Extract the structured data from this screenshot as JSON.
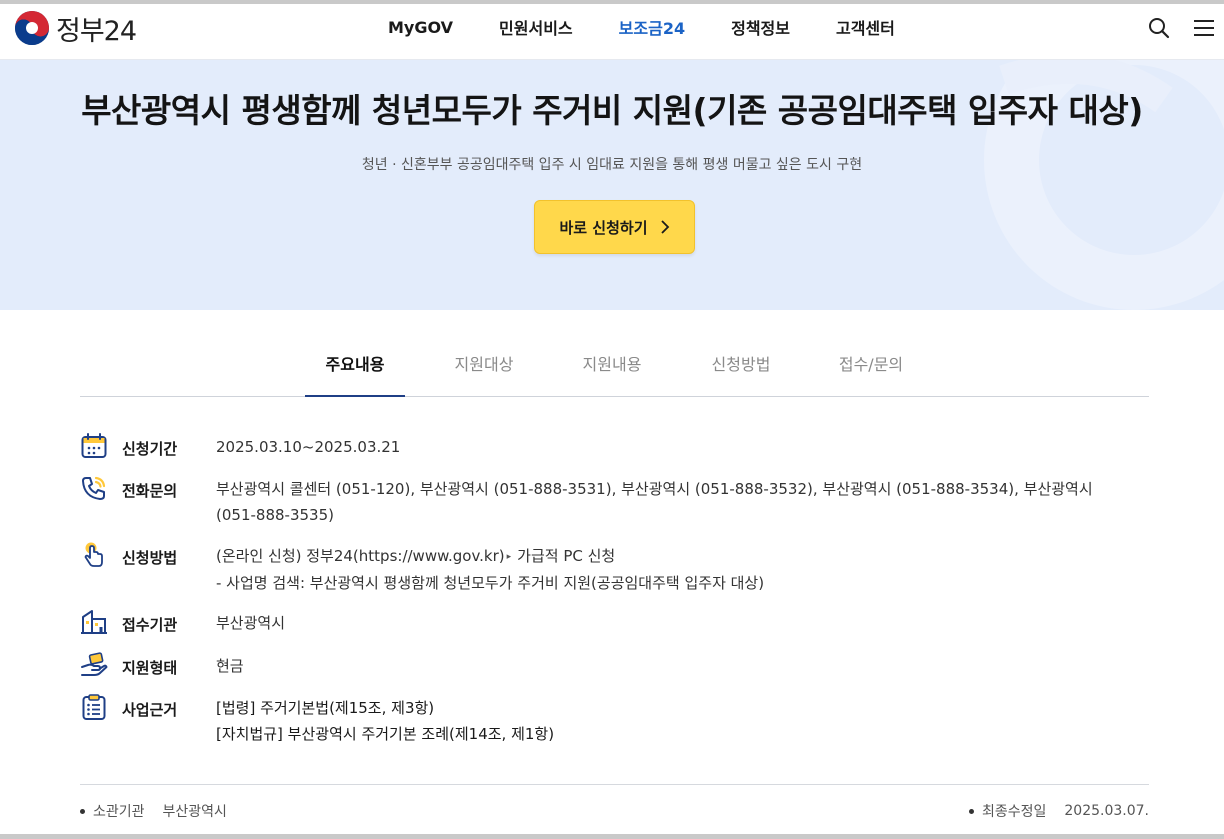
{
  "header": {
    "logo_text": "정부24",
    "nav": [
      {
        "label": "MyGOV",
        "active": false
      },
      {
        "label": "민원서비스",
        "active": false
      },
      {
        "label": "보조금24",
        "active": true
      },
      {
        "label": "정책정보",
        "active": false
      },
      {
        "label": "고객센터",
        "active": false
      }
    ],
    "icons": [
      "search-icon",
      "hamburger-menu-icon"
    ]
  },
  "hero": {
    "title": "부산광역시 평생함께 청년모두가 주거비 지원(기존 공공임대주택 입주자 대상)",
    "subtitle": "청년 · 신혼부부 공공임대주택 입주 시 임대료 지원을 통해 평생 머물고 싶은 도시 구현",
    "apply_button": "바로 신청하기"
  },
  "tabs": [
    {
      "label": "주요내용",
      "active": true
    },
    {
      "label": "지원대상",
      "active": false
    },
    {
      "label": "지원내용",
      "active": false
    },
    {
      "label": "신청방법",
      "active": false
    },
    {
      "label": "접수/문의",
      "active": false
    }
  ],
  "info": {
    "period": {
      "label": "신청기간",
      "value": "2025.03.10~2025.03.21",
      "icon": "calendar-icon"
    },
    "phone": {
      "label": "전화문의",
      "line1": "부산광역시 콜센터 (051-120), 부산광역시 (051-888-3531), 부산광역시 (051-888-3532), 부산광역시 (051-888-3534), 부산광역시",
      "line2": "(051-888-3535)",
      "icon": "phone-icon"
    },
    "method": {
      "label": "신청방법",
      "line1_a": "(온라인 신청) 정부24(https://www.gov.kr)",
      "line1_b": "가급적 PC 신청",
      "line2": "- 사업명 검색: 부산광역시 평생함께 청년모두가 주거비 지원(공공임대주택 입주자 대상)",
      "icon": "hand-pointer-icon"
    },
    "agency": {
      "label": "접수기관",
      "value": "부산광역시",
      "icon": "building-icon"
    },
    "type": {
      "label": "지원형태",
      "value": "현금",
      "icon": "money-hand-icon"
    },
    "basis": {
      "label": "사업근거",
      "line1": "[법령] 주거기본법(제15조, 제3항)",
      "line2": "[자치법규] 부산광역시 주거기본 조례(제14조, 제1항)",
      "icon": "checklist-icon"
    }
  },
  "footer": {
    "agency_label": "소관기관",
    "agency_value": "부산광역시",
    "updated_label": "최종수정일",
    "updated_value": "2025.03.07."
  },
  "colors": {
    "accent": "#1b63c6",
    "hero_bg": "#e3ecfb",
    "button": "#ffd84b",
    "tab_underline": "#1f3f86",
    "icon_blue": "#1f3f86",
    "icon_yellow": "#ffc83a"
  }
}
